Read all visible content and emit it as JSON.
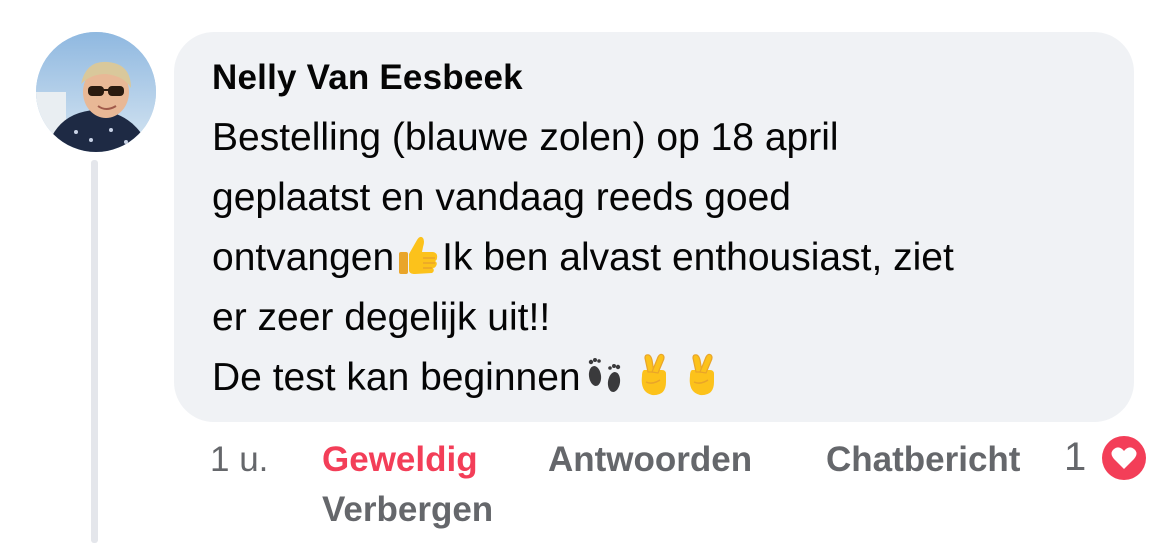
{
  "comment": {
    "author": "Nelly Van Eesbeek",
    "lines": [
      [
        "Bestelling (blauwe zolen) op 18 april"
      ],
      [
        "geplaatst en vandaag reeds goed"
      ],
      [
        "ontvangen",
        "Ik ben alvast enthousiast, ziet"
      ],
      [
        "er zeer degelijk uit!!"
      ],
      [
        "De test kan beginnen"
      ]
    ],
    "emojis": [
      "thumbs-up",
      "footprints",
      "crossed-fingers",
      "crossed-fingers"
    ]
  },
  "meta": {
    "time": "1 u.",
    "reaction_label": "Geweldig",
    "reply_label": "Antwoorden",
    "message_label": "Chatbericht",
    "hide_label": "Verbergen",
    "reaction_count": "1",
    "reaction_icon": "heart-icon"
  },
  "colors": {
    "bubble": "#f0f2f5",
    "text": "#050505",
    "muted": "#65676b",
    "love": "#f33e58",
    "thread": "#e4e6eb"
  }
}
